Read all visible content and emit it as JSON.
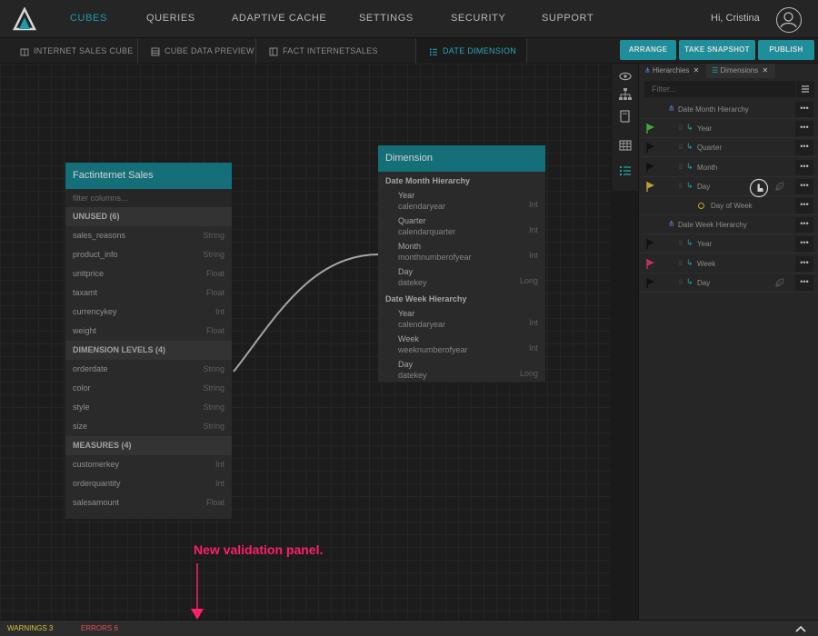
{
  "nav": {
    "items": [
      "CUBES",
      "QUERIES",
      "ADAPTIVE CACHE",
      "SETTINGS",
      "SECURITY",
      "SUPPORT"
    ],
    "active": "CUBES",
    "greeting": "Hi, Cristina"
  },
  "tabs": [
    "INTERNET SALES CUBE",
    "CUBE DATA PREVIEW",
    "FACT INTERNETSALES DATASET",
    "DATE DIMENSION"
  ],
  "toolbar": {
    "arrange": "ARRANGE",
    "snapshot": "TAKE SNAPSHOT",
    "publish": "PUBLISH"
  },
  "fact": {
    "title": "Factinternet Sales",
    "filter_placeholder": "filter columns...",
    "sections": [
      {
        "label": "UNUSED (6)",
        "rows": [
          {
            "name": "sales_reasons",
            "type": "String"
          },
          {
            "name": "product_info",
            "type": "String"
          },
          {
            "name": "unitprice",
            "type": "Float"
          },
          {
            "name": "taxamt",
            "type": "Float"
          },
          {
            "name": "currencykey",
            "type": "Int"
          },
          {
            "name": "weight",
            "type": "Float"
          }
        ]
      },
      {
        "label": "DIMENSION LEVELS (4)",
        "rows": [
          {
            "name": "orderdate",
            "type": "String"
          },
          {
            "name": "color",
            "type": "String"
          },
          {
            "name": "style",
            "type": "String"
          },
          {
            "name": "size",
            "type": "String"
          }
        ]
      },
      {
        "label": "MEASURES (4)",
        "rows": [
          {
            "name": "customerkey",
            "type": "Int"
          },
          {
            "name": "orderquantity",
            "type": "Int"
          },
          {
            "name": "salesamount",
            "type": "Float"
          }
        ]
      }
    ]
  },
  "dimension": {
    "title": "Dimension",
    "hierarchies": [
      {
        "name": "Date Month Hierarchy",
        "levels": [
          {
            "name": "Year",
            "column": "calendaryear",
            "type": "Int"
          },
          {
            "name": "Quarter",
            "column": "calendarquarter",
            "type": "Int"
          },
          {
            "name": "Month",
            "column": "monthnumberofyear",
            "type": "Int"
          },
          {
            "name": "Day",
            "column": "datekey",
            "type": "Long"
          }
        ]
      },
      {
        "name": "Date Week Hierarchy",
        "levels": [
          {
            "name": "Year",
            "column": "calendaryear",
            "type": "Int"
          },
          {
            "name": "Week",
            "column": "weeknumberofyear",
            "type": "Int"
          },
          {
            "name": "Day",
            "column": "datekey",
            "type": "Long"
          }
        ]
      }
    ]
  },
  "panel": {
    "tab_hierarchies": "Hierarchies",
    "tab_dimensions": "Dimensions",
    "filter_placeholder": "Filter...",
    "more_label": "•••",
    "tree": [
      {
        "label": "Date Month Hierarchy",
        "kind": "hierarchy",
        "flag": ""
      },
      {
        "label": "Year",
        "kind": "level",
        "flag": "#3ea83e"
      },
      {
        "label": "Quarter",
        "kind": "level",
        "flag": "#111111"
      },
      {
        "label": "Month",
        "kind": "level",
        "flag": "#111111"
      },
      {
        "label": "Day",
        "kind": "level",
        "flag": "#b9a234"
      },
      {
        "label": "Day of Week",
        "kind": "attribute",
        "flag": ""
      },
      {
        "label": "Date Week Hierarchy",
        "kind": "hierarchy",
        "flag": ""
      },
      {
        "label": "Year",
        "kind": "level",
        "flag": "#111111"
      },
      {
        "label": "Week",
        "kind": "level",
        "flag": "#c2305a"
      },
      {
        "label": "Day",
        "kind": "level",
        "flag": "#111111"
      }
    ]
  },
  "annotation": "New validation panel.",
  "status": {
    "warnings": "WARNINGS  3",
    "errors": "ERRORS  6"
  },
  "colors": {
    "accent": "#1e9aa8",
    "annotation": "#ff1f6a",
    "warning": "#d7c240",
    "error": "#e4505a"
  }
}
